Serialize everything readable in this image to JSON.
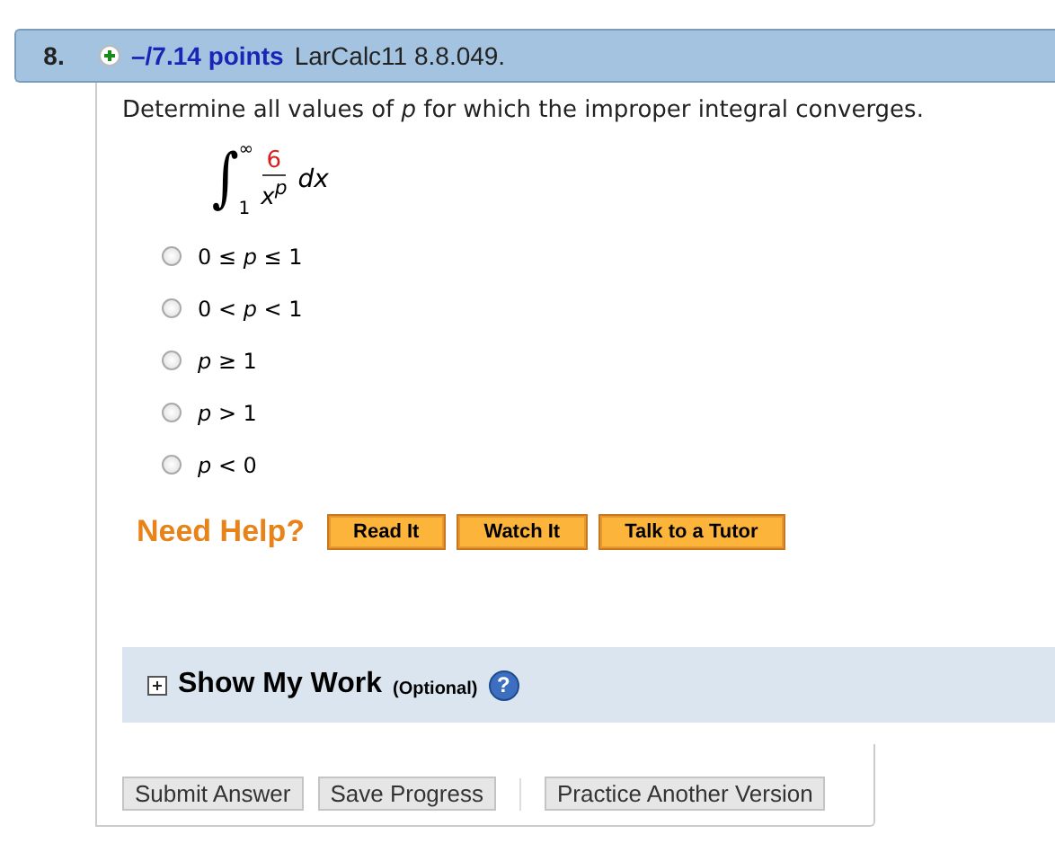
{
  "question": {
    "number": "8.",
    "points": "–/7.14 points",
    "source": "LarCalc11 8.8.049."
  },
  "prompt": "Determine all values of *p* for which the improper integral converges.",
  "integral": {
    "sign": "∫",
    "upper": "∞",
    "lower": "1",
    "numerator": "6",
    "denominator": "x$^{p}$",
    "differential": "dx"
  },
  "options": [
    {
      "label": "0 ≤ *p* ≤ 1",
      "selected": false
    },
    {
      "label": "0 < *p* < 1",
      "selected": false
    },
    {
      "label": "*p* ≥ 1",
      "selected": false
    },
    {
      "label": "*p* > 1",
      "selected": false
    },
    {
      "label": "*p* < 0",
      "selected": false
    }
  ],
  "help": {
    "label": "Need Help?",
    "buttons": [
      "Read It",
      "Watch It",
      "Talk to a Tutor"
    ]
  },
  "show_my_work": {
    "title": "Show My Work",
    "note": "(Optional)",
    "help": "?",
    "expanded": false
  },
  "actions": [
    "Submit Answer",
    "Save Progress",
    "Practice Another Version"
  ]
}
